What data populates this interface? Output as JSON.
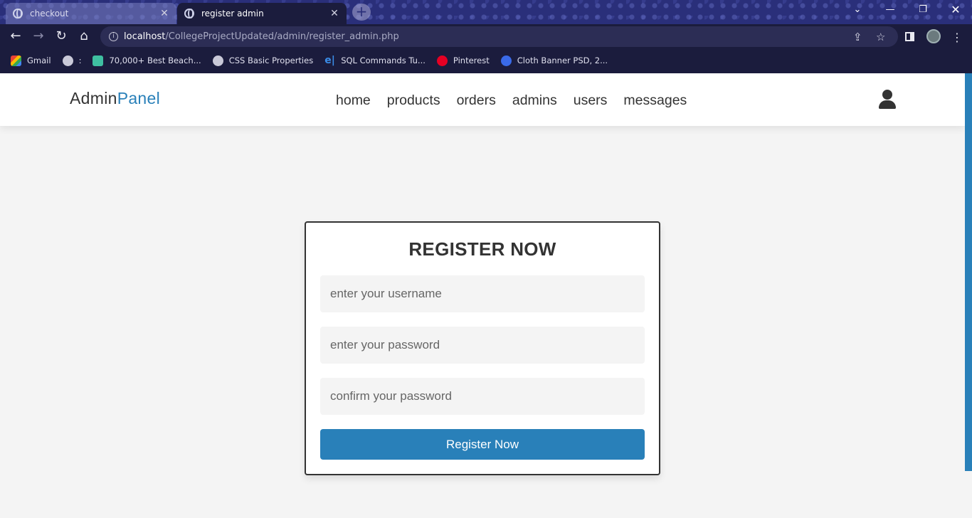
{
  "browser": {
    "tabs": [
      {
        "title": "checkout",
        "active": false
      },
      {
        "title": "register admin",
        "active": true
      }
    ],
    "url_host": "localhost",
    "url_path": "/CollegeProjectUpdated/admin/register_admin.php",
    "bookmarks": [
      {
        "label": "Gmail",
        "icon": "gmail-icon"
      },
      {
        "label": ":",
        "icon": "globe-icon"
      },
      {
        "label": "70,000+ Best Beach...",
        "icon": "d-icon"
      },
      {
        "label": "CSS Basic Properties",
        "icon": "globe-icon"
      },
      {
        "label": "SQL Commands Tu...",
        "icon": "e-icon"
      },
      {
        "label": "Pinterest",
        "icon": "pinterest-icon"
      },
      {
        "label": "Cloth Banner PSD, 2...",
        "icon": "crown-icon"
      }
    ]
  },
  "header": {
    "logo_main": "Admin",
    "logo_accent": "Panel",
    "nav": [
      "home",
      "products",
      "orders",
      "admins",
      "users",
      "messages"
    ]
  },
  "form": {
    "title": "REGISTER NOW",
    "username_placeholder": "enter your username",
    "password_placeholder": "enter your password",
    "confirm_placeholder": "confirm your password",
    "submit_label": "Register Now"
  },
  "colors": {
    "accent": "#2980b9",
    "text": "#333333",
    "background": "#f4f4f4"
  }
}
